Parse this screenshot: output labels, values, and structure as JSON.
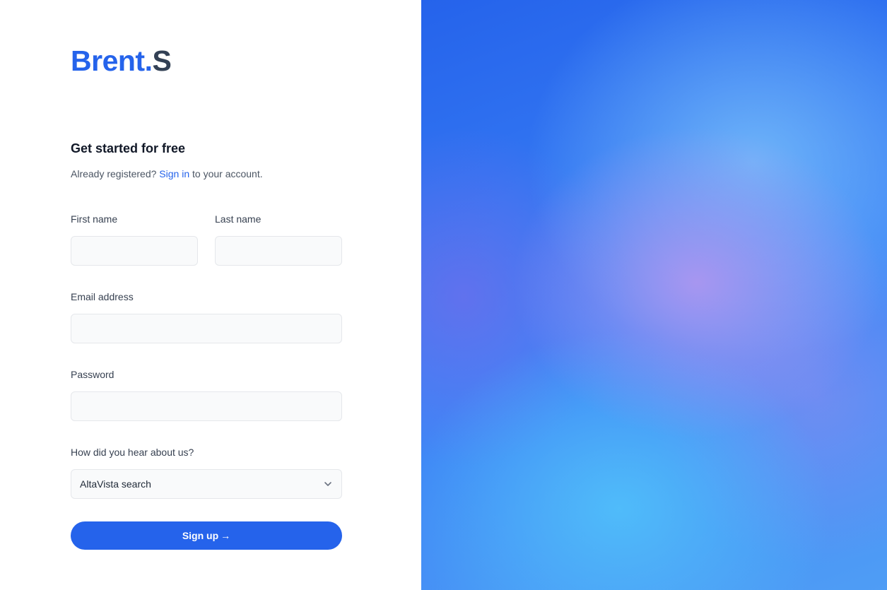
{
  "logo": {
    "brand": "Brent",
    "dot": ".",
    "suffix": "S"
  },
  "form": {
    "heading": "Get started for free",
    "subtext_prefix": "Already registered?",
    "signin_link": "Sign in",
    "subtext_suffix": "to your account.",
    "first_name": {
      "label": "First name",
      "value": ""
    },
    "last_name": {
      "label": "Last name",
      "value": ""
    },
    "email": {
      "label": "Email address",
      "value": ""
    },
    "password": {
      "label": "Password",
      "value": ""
    },
    "referral": {
      "label": "How did you hear about us?",
      "selected": "AltaVista search"
    },
    "submit": {
      "label": "Sign up",
      "arrow": "→"
    }
  },
  "colors": {
    "accent": "#2563eb",
    "logo_suffix": "#334155",
    "input_bg": "#f9fafb",
    "input_border": "#e5e7eb"
  },
  "icons": {
    "select_chevron": "chevron-down-icon",
    "submit_arrow": "arrow-right-icon"
  }
}
